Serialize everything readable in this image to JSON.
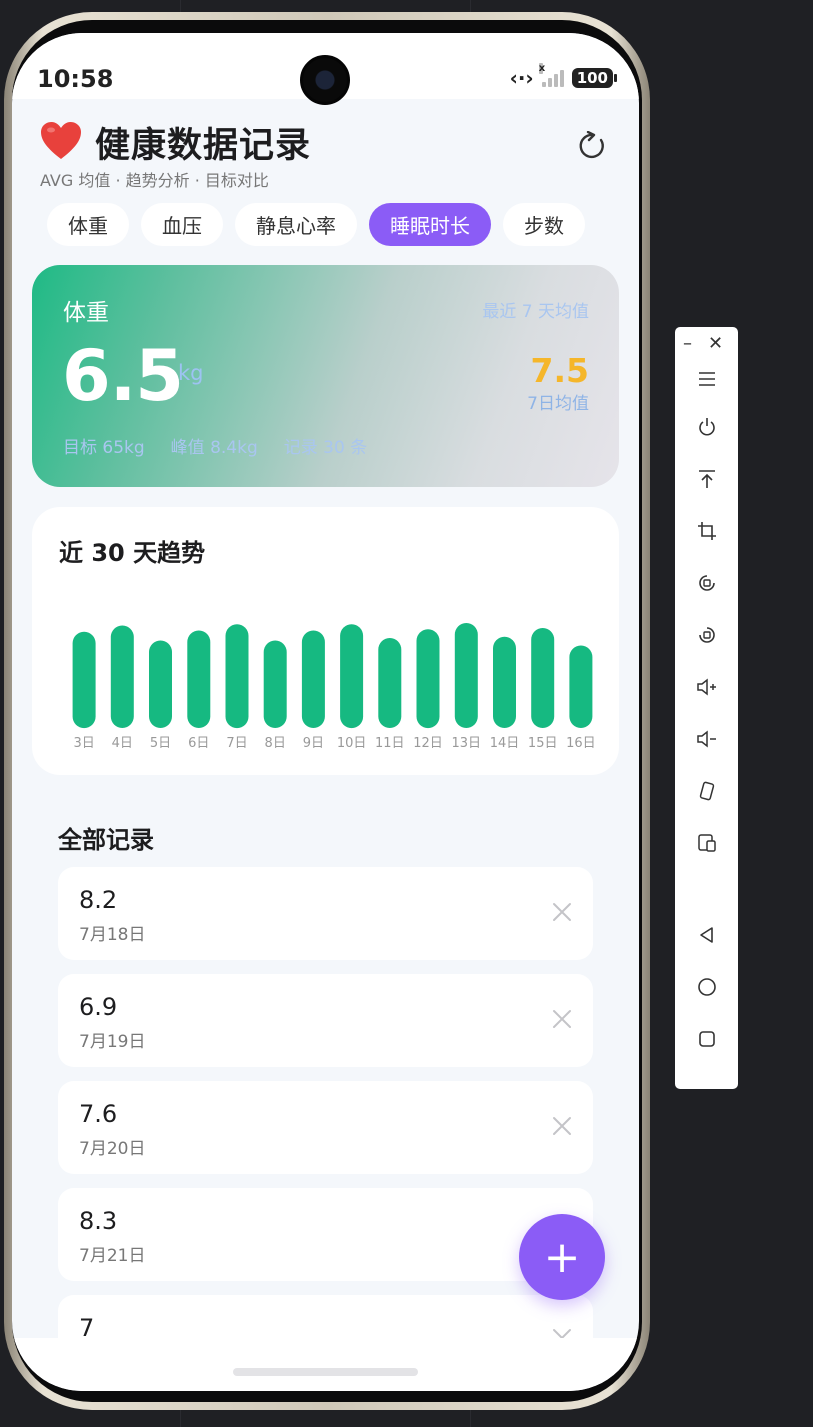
{
  "status_bar": {
    "time": "10:58",
    "battery": "100"
  },
  "header": {
    "title": "健康数据记录",
    "subtitle": "AVG 均值 · 趋势分析 · 目标对比"
  },
  "tabs": [
    {
      "label": "体重",
      "active": false
    },
    {
      "label": "血压",
      "active": false
    },
    {
      "label": "静息心率",
      "active": false
    },
    {
      "label": "睡眠时长",
      "active": true
    },
    {
      "label": "步数",
      "active": false
    }
  ],
  "summary": {
    "label": "体重",
    "period": "最近 7 天均值",
    "value": "6.5",
    "unit": "kg",
    "avg_value": "7.5",
    "avg_label": "7日均值",
    "target": "目标 65kg",
    "peak": "峰值 8.4kg",
    "count": "记录 30 条"
  },
  "trend": {
    "title": "近 30 天趋势"
  },
  "chart_data": {
    "type": "bar",
    "categories": [
      "3日",
      "4日",
      "5日",
      "6日",
      "7日",
      "8日",
      "9日",
      "10日",
      "11日",
      "12日",
      "13日",
      "14日",
      "15日",
      "16日"
    ],
    "values": [
      7.7,
      8.2,
      7.0,
      7.8,
      8.3,
      7.0,
      7.8,
      8.3,
      7.2,
      7.9,
      8.4,
      7.3,
      8.0,
      6.6
    ],
    "title": "近 30 天趋势",
    "xlabel": "",
    "ylabel": "",
    "ylim": [
      0,
      8.4
    ],
    "color": "#16b981"
  },
  "records": {
    "title": "全部记录",
    "items": [
      {
        "value": "8.2",
        "date": "7月18日"
      },
      {
        "value": "6.9",
        "date": "7月19日"
      },
      {
        "value": "7.6",
        "date": "7月20日"
      },
      {
        "value": "8.3",
        "date": "7月21日"
      },
      {
        "value": "7",
        "date": ""
      }
    ]
  },
  "fab": {
    "label": "+"
  },
  "colors": {
    "accent": "#8b5cf6",
    "bar": "#16b981",
    "avg": "#f5b62a"
  }
}
